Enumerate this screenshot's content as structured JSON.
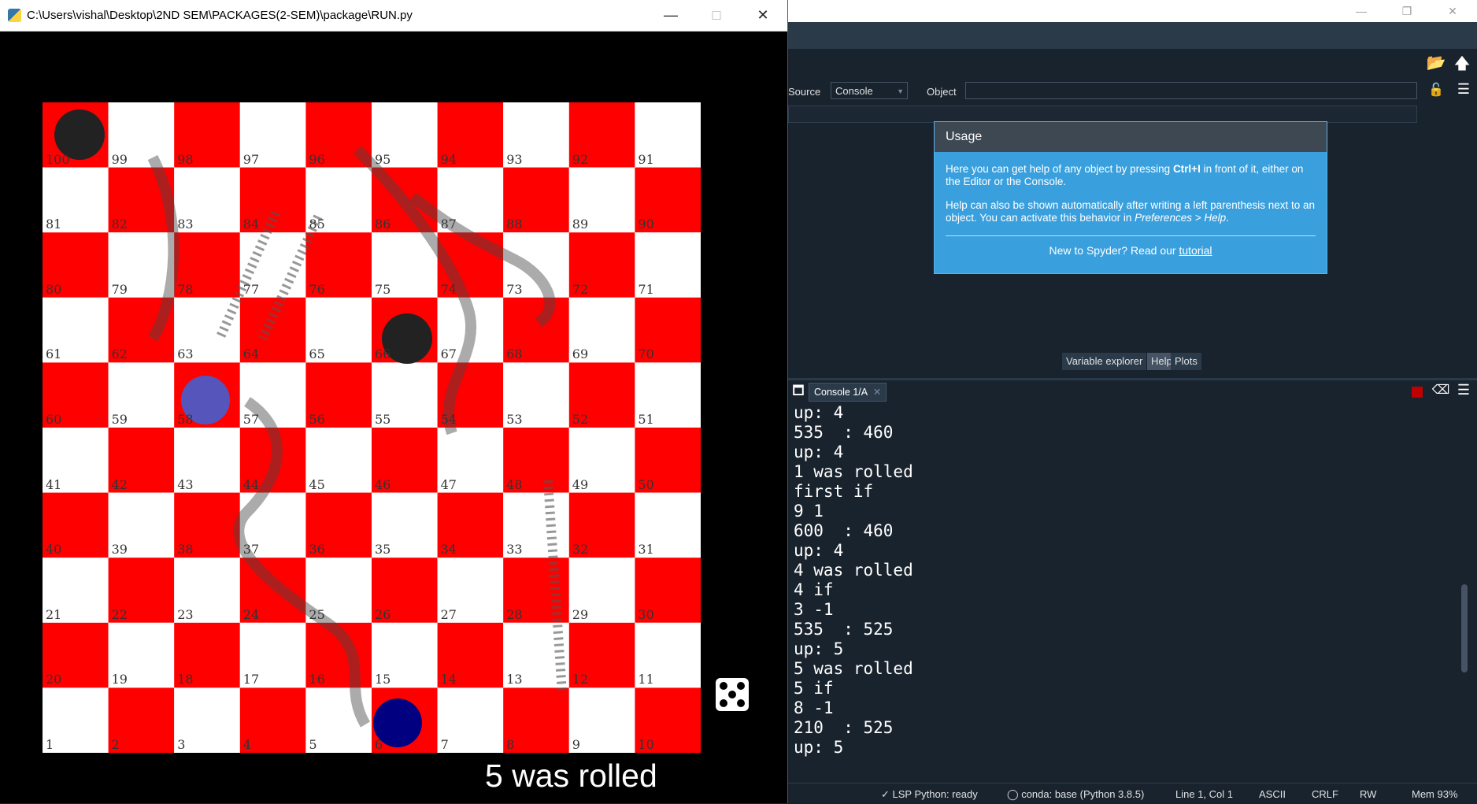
{
  "game": {
    "window_title": "C:\\Users\\vishal\\Desktop\\2ND SEM\\PACKAGES(2-SEM)\\package\\RUN.py",
    "board_numbers": [
      [
        100,
        99,
        98,
        97,
        96,
        95,
        94,
        93,
        92,
        91
      ],
      [
        81,
        82,
        83,
        84,
        85,
        86,
        87,
        88,
        89,
        90
      ],
      [
        80,
        79,
        78,
        77,
        76,
        75,
        74,
        73,
        72,
        71
      ],
      [
        61,
        62,
        63,
        64,
        65,
        66,
        67,
        68,
        69,
        70
      ],
      [
        60,
        59,
        58,
        57,
        56,
        55,
        54,
        53,
        52,
        51
      ],
      [
        41,
        42,
        43,
        44,
        45,
        46,
        47,
        48,
        49,
        50
      ],
      [
        40,
        39,
        38,
        37,
        36,
        35,
        34,
        33,
        32,
        31
      ],
      [
        21,
        22,
        23,
        24,
        25,
        26,
        27,
        28,
        29,
        30
      ],
      [
        20,
        19,
        18,
        17,
        16,
        15,
        14,
        13,
        12,
        11
      ],
      [
        1,
        2,
        3,
        4,
        5,
        6,
        7,
        8,
        9,
        10
      ]
    ],
    "colors": {
      "red": "#ff0000",
      "white": "#ffffff",
      "player1": "#000080",
      "player2": "#5555bb"
    },
    "dice_value": 5,
    "roll_status": "5 was rolled"
  },
  "spyder": {
    "source_label": "Source",
    "source_value": "Console",
    "object_label": "Object",
    "usage": {
      "title": "Usage",
      "p1_a": "Here you can get help of any object by pressing ",
      "p1_b": "Ctrl+I",
      "p1_c": " in front of it, either on the Editor or the Console.",
      "p2_a": "Help can also be shown automatically after writing a left parenthesis next to an object. You can activate this behavior in ",
      "p2_b": "Preferences > Help",
      "p2_c": ".",
      "footer": "New to Spyder? Read our ",
      "footer_link": "tutorial"
    },
    "pane_tabs": [
      "Variable explorer",
      "Help",
      "Plots"
    ],
    "console_tab": "Console 1/A",
    "console_lines": [
      "up: 4",
      "535  : 460",
      "up: 4",
      "1 was rolled",
      "first if",
      "9 1",
      "600  : 460",
      "up: 4",
      "4 was rolled",
      "4 if",
      "3 -1",
      "535  : 525",
      "up: 5",
      "5 was rolled",
      "5 if",
      "8 -1",
      "210  : 525",
      "up: 5"
    ],
    "status": {
      "lsp": "LSP Python: ready",
      "conda": "conda: base (Python 3.8.5)",
      "position": "Line 1, Col 1",
      "encoding": "ASCII",
      "eol": "CRLF",
      "mode": "RW",
      "mem": "Mem 93%"
    }
  }
}
